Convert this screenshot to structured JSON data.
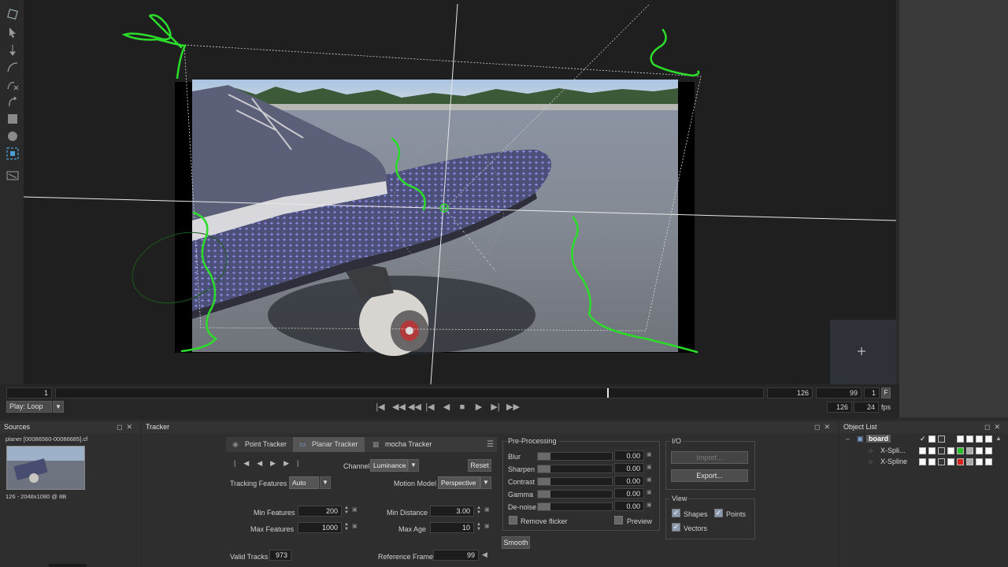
{
  "timeline": {
    "start_frame": "1",
    "end_frame": "126",
    "current_frame": "99",
    "step": "1",
    "f_label": "F",
    "play_mode": "Play: Loop",
    "out_frame": "126",
    "fps_value": "24",
    "fps_label": "fps",
    "playhead_fraction": 0.78
  },
  "sources": {
    "title": "Sources",
    "clip_name": "planer [00086560-00086685].cf",
    "clip_info": "126 - 2048x1080 @ 8B"
  },
  "tracker": {
    "title": "Tracker",
    "tabs": [
      "Point Tracker",
      "Planar Tracker",
      "mocha Tracker"
    ],
    "active_tab": "Planar Tracker",
    "channel_label": "Channel",
    "channel_value": "Luminance",
    "reset_label": "Reset",
    "tracking_features_label": "Tracking Features",
    "tracking_features_value": "Auto",
    "motion_model_label": "Motion Model",
    "motion_model_value": "Perspective",
    "min_features_label": "Min Features",
    "min_features_value": "200",
    "max_features_label": "Max Features",
    "max_features_value": "1000",
    "min_distance_label": "Min Distance",
    "min_distance_value": "3.00",
    "max_age_label": "Max Age",
    "max_age_value": "10",
    "valid_tracks_label": "Valid Tracks",
    "valid_tracks_value": "973",
    "reference_frame_label": "Reference Frame",
    "reference_frame_value": "99"
  },
  "preprocessing": {
    "title": "Pre-Processing",
    "rows": [
      {
        "label": "Blur",
        "value": "0.00"
      },
      {
        "label": "Sharpen",
        "value": "0.00"
      },
      {
        "label": "Contrast",
        "value": "0.00"
      },
      {
        "label": "Gamma",
        "value": "0.00"
      },
      {
        "label": "De-noise",
        "value": "0.00"
      }
    ],
    "remove_flicker_label": "Remove flicker",
    "preview_label": "Preview",
    "smooth_label": "Smooth"
  },
  "io": {
    "title": "I/O",
    "import_label": "Import...",
    "export_label": "Export..."
  },
  "view": {
    "title": "View",
    "shapes_label": "Shapes",
    "points_label": "Points",
    "vectors_label": "Vectors"
  },
  "object_list": {
    "title": "Object List",
    "items": [
      {
        "name": "board",
        "level": 0
      },
      {
        "name": "X-Spli...",
        "level": 1
      },
      {
        "name": "X-Spline",
        "level": 1
      }
    ]
  },
  "colors": {
    "track_green": "#2bdc2b",
    "feature_blue": "#8a8cff",
    "accent": "#5b7fb0"
  }
}
